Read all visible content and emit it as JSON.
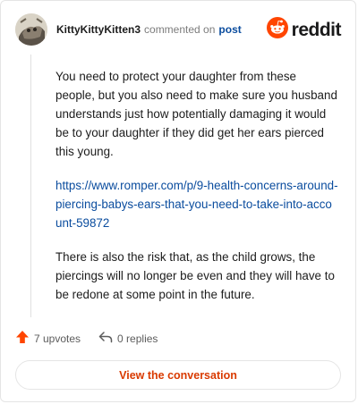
{
  "header": {
    "author": "KittyKittyKitten3",
    "commented_text": "commented on",
    "post_link": "post"
  },
  "brand": {
    "name": "reddit",
    "logo_icon": "reddit-snoo-icon",
    "accent_color": "#ff4500"
  },
  "comment": {
    "paragraph_1": "You need to protect your daughter from these people, but you also need to make sure you husband understands just how potentially damaging it would be to your daughter if they did get her ears pierced this young.",
    "link": "https://www.romper.com/p/9-health-concerns-around-piercing-babys-ears-that-you-need-to-take-into-account-59872",
    "paragraph_2": "There is also the risk that, as the child grows, the piercings will no longer be even and they will have to be redone at some point in the future."
  },
  "actions": {
    "upvotes": "7 upvotes",
    "replies": "0 replies",
    "upvote_color": "#ff4500"
  },
  "footer": {
    "view_conversation": "View the conversation"
  }
}
